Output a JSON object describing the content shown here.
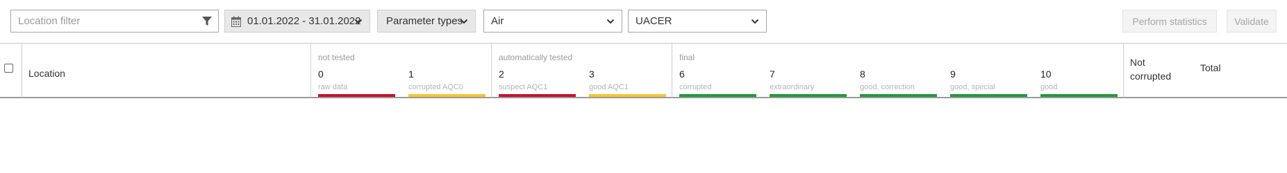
{
  "toolbar": {
    "location_filter_placeholder": "Location filter",
    "date_range": "01.01.2022 - 31.01.2022",
    "parameter_types": "Parameter types",
    "medium": "Air",
    "network": "UACER",
    "perform_statistics": "Perform statistics",
    "validate": "Validate"
  },
  "table": {
    "location_header": "Location",
    "groups": [
      {
        "title": "not tested"
      },
      {
        "title": "automatically tested"
      },
      {
        "title": "final"
      }
    ],
    "columns": [
      {
        "code": "0",
        "label": "raw data",
        "color": "#c8102e"
      },
      {
        "code": "1",
        "label": "corrupted AQC0",
        "color": "#f6c530"
      },
      {
        "code": "2",
        "label": "suspect AQC1",
        "color": "#c8102e"
      },
      {
        "code": "3",
        "label": "good AQC1",
        "color": "#f6c530"
      },
      {
        "code": "6",
        "label": "corrupted",
        "color": "#1f9a3b"
      },
      {
        "code": "7",
        "label": "extraordinary",
        "color": "#1f9a3b"
      },
      {
        "code": "8",
        "label": "good, correction",
        "color": "#1f9a3b"
      },
      {
        "code": "9",
        "label": "good, special",
        "color": "#1f9a3b"
      },
      {
        "code": "10",
        "label": "good",
        "color": "#1f9a3b"
      }
    ],
    "not_corrupted": "Not corrupted",
    "total": "Total"
  },
  "icons": {
    "filter": "filter-icon",
    "calendar": "calendar-icon",
    "dropdown": "chevron-down-icon"
  }
}
